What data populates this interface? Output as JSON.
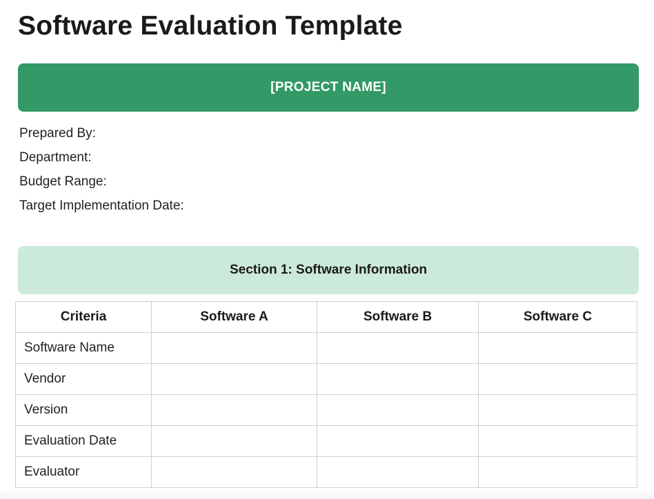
{
  "document": {
    "title": "Software Evaluation Template",
    "project_banner": "[PROJECT NAME]",
    "meta_fields": [
      "Prepared By:",
      "Department:",
      "Budget Range:",
      "Target Implementation Date:"
    ],
    "section_title": "Section 1: Software Information"
  },
  "table": {
    "headers": [
      "Criteria",
      "Software A",
      "Software B",
      "Software C"
    ],
    "rows": [
      [
        "Software Name",
        "",
        "",
        ""
      ],
      [
        "Vendor",
        "",
        "",
        ""
      ],
      [
        "Version",
        "",
        "",
        ""
      ],
      [
        "Evaluation Date",
        "",
        "",
        ""
      ],
      [
        "Evaluator",
        "",
        "",
        ""
      ]
    ]
  },
  "colors": {
    "project_banner_bg": "#339966",
    "section_banner_bg": "#cceadb"
  }
}
